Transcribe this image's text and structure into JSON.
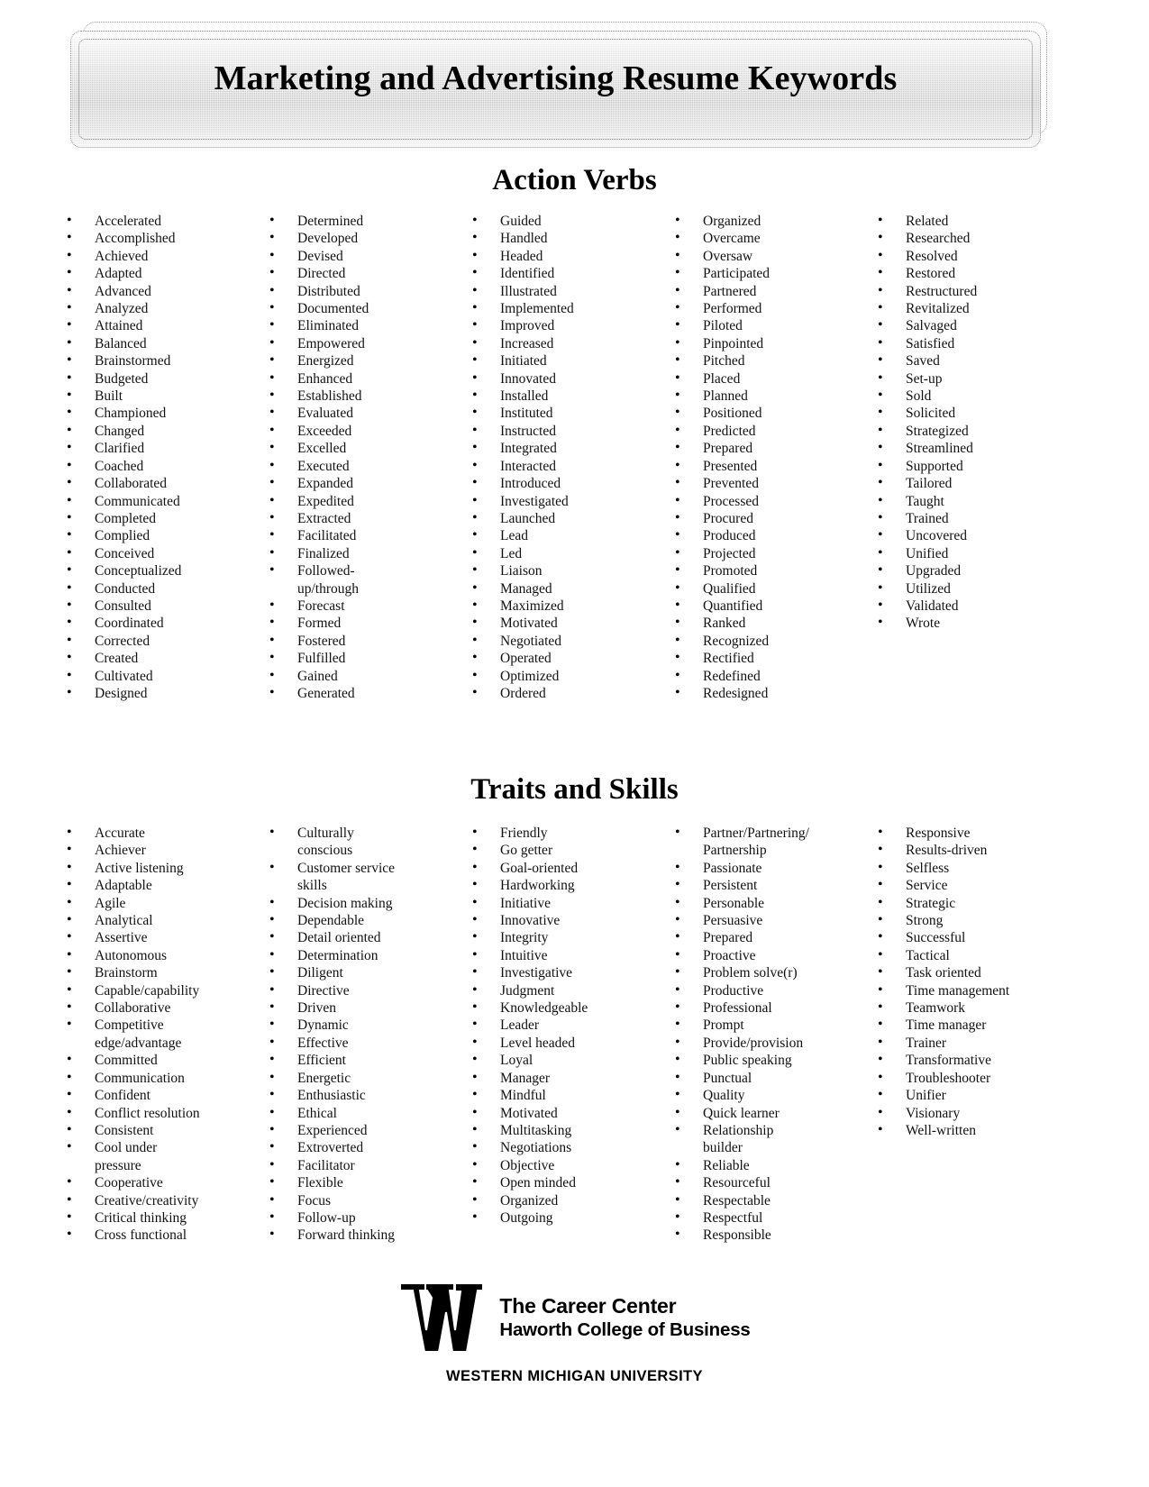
{
  "document": {
    "title": "Marketing and Advertising Resume Keywords"
  },
  "sections": [
    {
      "id": "action-verbs",
      "heading": "Action Verbs",
      "columns": [
        {
          "items": [
            "Accelerated",
            "Accomplished",
            "Achieved",
            "Adapted",
            "Advanced",
            "Analyzed",
            "Attained",
            "Balanced",
            "Brainstormed",
            "Budgeted",
            "Built",
            "Championed",
            "Changed",
            "Clarified",
            "Coached",
            "Collaborated",
            "Communicated",
            "Completed",
            "Complied",
            "Conceived",
            "Conceptualized",
            "Conducted",
            "Consulted",
            "Coordinated",
            "Corrected",
            "Created",
            "Cultivated",
            "Designed"
          ]
        },
        {
          "items": [
            "Determined",
            "Developed",
            "Devised",
            "Directed",
            "Distributed",
            "Documented",
            "Eliminated",
            "Empowered",
            "Energized",
            "Enhanced",
            "Established",
            "Evaluated",
            "Exceeded",
            "Excelled",
            "Executed",
            "Expanded",
            "Expedited",
            "Extracted",
            "Facilitated",
            "Finalized",
            "Followed-\nup/through",
            "Forecast",
            "Formed",
            "Fostered",
            "Fulfilled",
            "Gained",
            "Generated"
          ]
        },
        {
          "items": [
            "Guided",
            "Handled",
            "Headed",
            "Identified",
            "Illustrated",
            "Implemented",
            "Improved",
            "Increased",
            "Initiated",
            "Innovated",
            "Installed",
            "Instituted",
            "Instructed",
            "Integrated",
            "Interacted",
            "Introduced",
            "Investigated",
            "Launched",
            "Lead",
            "Led",
            "Liaison",
            "Managed",
            "Maximized",
            "Motivated",
            "Negotiated",
            "Operated",
            "Optimized",
            "Ordered"
          ]
        },
        {
          "items": [
            "Organized",
            "Overcame",
            "Oversaw",
            "Participated",
            "Partnered",
            "Performed",
            "Piloted",
            "Pinpointed",
            "Pitched",
            "Placed",
            "Planned",
            "Positioned",
            "Predicted",
            "Prepared",
            "Presented",
            "Prevented",
            "Processed",
            "Procured",
            "Produced",
            "Projected",
            "Promoted",
            "Qualified",
            "Quantified",
            "Ranked",
            "Recognized",
            "Rectified",
            "Redefined",
            "Redesigned"
          ]
        },
        {
          "items": [
            "Related",
            "Researched",
            "Resolved",
            "Restored",
            "Restructured",
            "Revitalized",
            "Salvaged",
            "Satisfied",
            "Saved",
            "Set-up",
            "Sold",
            "Solicited",
            "Strategized",
            "Streamlined",
            "Supported",
            "Tailored",
            "Taught",
            "Trained",
            "Uncovered",
            "Unified",
            "Upgraded",
            "Utilized",
            "Validated",
            "Wrote"
          ]
        }
      ]
    },
    {
      "id": "traits-and-skills",
      "heading": "Traits and Skills",
      "columns": [
        {
          "items": [
            "Accurate",
            "Achiever",
            "Active listening",
            "Adaptable",
            "Agile",
            "Analytical",
            "Assertive",
            "Autonomous",
            "Brainstorm",
            "Capable/capability",
            "Collaborative",
            "Competitive\nedge/advantage",
            "Committed",
            "Communication",
            "Confident",
            "Conflict resolution",
            "Consistent",
            "Cool under\npressure",
            "Cooperative",
            "Creative/creativity",
            "Critical thinking",
            "Cross functional"
          ]
        },
        {
          "items": [
            "Culturally\nconscious",
            "Customer service\nskills",
            "Decision making",
            "Dependable",
            "Detail oriented",
            "Determination",
            "Diligent",
            "Directive",
            "Driven",
            "Dynamic",
            "Effective",
            "Efficient",
            "Energetic",
            "Enthusiastic",
            "Ethical",
            "Experienced",
            "Extroverted",
            "Facilitator",
            "Flexible",
            "Focus",
            "Follow-up",
            "Forward thinking"
          ]
        },
        {
          "items": [
            "Friendly",
            "Go getter",
            "Goal-oriented",
            "Hardworking",
            "Initiative",
            "Innovative",
            "Integrity",
            "Intuitive",
            "Investigative",
            "Judgment",
            "Knowledgeable",
            "Leader",
            "Level headed",
            "Loyal",
            "Manager",
            "Mindful",
            "Motivated",
            "Multitasking",
            "Negotiations",
            "Objective",
            "Open minded",
            "Organized",
            "Outgoing"
          ]
        },
        {
          "items": [
            "Partner/Partnering/\nPartnership",
            "Passionate",
            "Persistent",
            "Personable",
            "Persuasive",
            "Prepared",
            "Proactive",
            "Problem solve(r)",
            "Productive",
            "Professional",
            "Prompt",
            "Provide/provision",
            "Public speaking",
            "Punctual",
            "Quality",
            "Quick learner",
            "Relationship\nbuilder",
            "Reliable",
            "Resourceful",
            "Respectable",
            "Respectful",
            "Responsible"
          ]
        },
        {
          "items": [
            "Responsive",
            "Results-driven",
            "Selfless",
            "Service",
            "Strategic",
            "Strong",
            "Successful",
            "Tactical",
            "Task oriented",
            "Time management",
            "Teamwork",
            "Time manager",
            "Trainer",
            "Transformative",
            "Troubleshooter",
            "Unifier",
            "Visionary",
            "Well-written"
          ]
        }
      ]
    }
  ],
  "footer": {
    "logo_letter": "W",
    "line1": "The Career Center",
    "line2": "Haworth College of Business",
    "university": "WESTERN MICHIGAN UNIVERSITY"
  }
}
